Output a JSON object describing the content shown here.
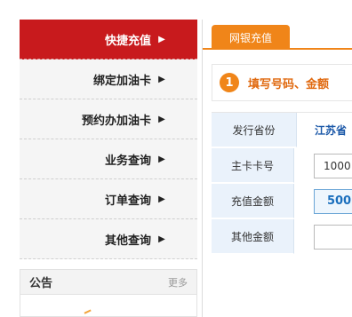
{
  "sidebar": {
    "items": [
      {
        "label": "快捷充值",
        "arrow": "▶"
      },
      {
        "label": "绑定加油卡",
        "arrow": "▶"
      },
      {
        "label": "预约办加油卡",
        "arrow": "▶"
      },
      {
        "label": "业务查询",
        "arrow": "▶"
      },
      {
        "label": "订单查询",
        "arrow": "▶"
      },
      {
        "label": "其他查询",
        "arrow": "▶"
      }
    ]
  },
  "notice": {
    "title": "公告",
    "more": "更多"
  },
  "main": {
    "tab_label": "网银充值",
    "step": {
      "number": "1",
      "text": "填写号码、金额"
    },
    "form": {
      "province_label": "发行省份",
      "province_value": "江苏省",
      "card_label": "主卡卡号",
      "card_value": "1000",
      "amount_label": "充值金额",
      "amount_value": "500",
      "other_label": "其他金额",
      "other_value": ""
    }
  },
  "colors": {
    "accent_red": "#c81a1d",
    "accent_orange": "#f08519",
    "link_blue": "#1b58a8"
  }
}
